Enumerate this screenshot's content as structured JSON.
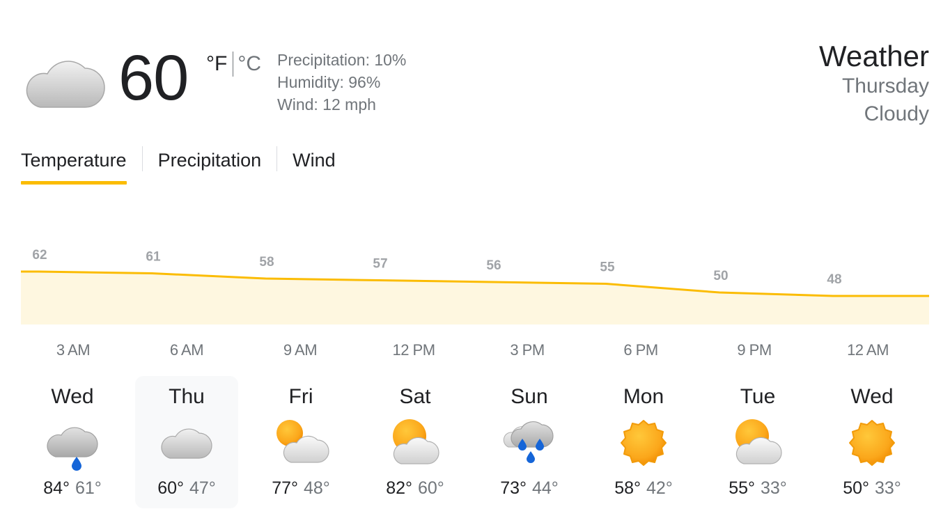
{
  "current": {
    "icon": "cloudy-icon",
    "temperature": "60",
    "unit_f": "°F",
    "unit_c": "°C",
    "precipitation": "Precipitation: 10%",
    "humidity": "Humidity: 96%",
    "wind": "Wind: 12 mph"
  },
  "header": {
    "title": "Weather",
    "day": "Thursday",
    "condition": "Cloudy"
  },
  "tabs": [
    {
      "label": "Temperature",
      "active": true
    },
    {
      "label": "Precipitation",
      "active": false
    },
    {
      "label": "Wind",
      "active": false
    }
  ],
  "chart_data": {
    "type": "area",
    "x": [
      "3 AM",
      "6 AM",
      "9 AM",
      "12 PM",
      "3 PM",
      "6 PM",
      "9 PM",
      "12 AM"
    ],
    "values": [
      62,
      61,
      58,
      57,
      56,
      55,
      50,
      48
    ],
    "line_color": "#fbbc04",
    "fill_color": "#fef7e0",
    "grid": false
  },
  "forecast": [
    {
      "day": "Wed",
      "icon": "cloud-rain-icon",
      "high": "84°",
      "low": "61°",
      "selected": false
    },
    {
      "day": "Thu",
      "icon": "cloudy-icon",
      "high": "60°",
      "low": "47°",
      "selected": true
    },
    {
      "day": "Fri",
      "icon": "partly-cloudy-icon",
      "high": "77°",
      "low": "48°",
      "selected": false
    },
    {
      "day": "Sat",
      "icon": "partly-cloudy-icon",
      "high": "82°",
      "low": "60°",
      "selected": false
    },
    {
      "day": "Sun",
      "icon": "heavy-rain-icon",
      "high": "73°",
      "low": "44°",
      "selected": false
    },
    {
      "day": "Mon",
      "icon": "sunny-icon",
      "high": "58°",
      "low": "42°",
      "selected": false
    },
    {
      "day": "Tue",
      "icon": "partly-cloudy-icon",
      "high": "55°",
      "low": "33°",
      "selected": false
    },
    {
      "day": "Wed",
      "icon": "sunny-icon",
      "high": "50°",
      "low": "33°",
      "selected": false
    }
  ]
}
